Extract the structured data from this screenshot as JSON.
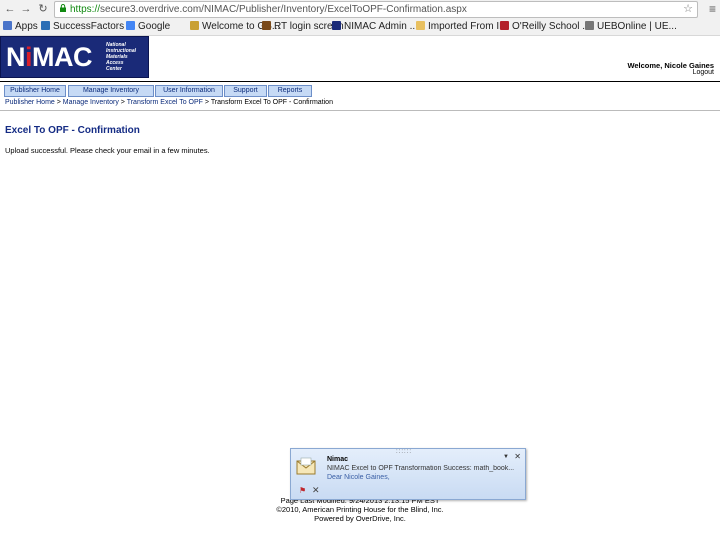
{
  "browser": {
    "url_scheme": "https://",
    "url_rest": "secure3.overdrive.com/NIMAC/Publisher/Inventory/ExcelToOPF-Confirmation.aspx",
    "bookmarks": [
      {
        "label": "Apps",
        "icon": "apps-grid-icon",
        "color": "#4a74c9"
      },
      {
        "label": "SuccessFactors ...",
        "icon": "successfactors-icon",
        "color": "#2d6fb5"
      },
      {
        "label": "Google",
        "icon": "google-icon",
        "color": "#4285f4"
      },
      {
        "label": "Welcome to GS...",
        "icon": "page-icon",
        "color": "#c9a032"
      },
      {
        "label": "RT login screen",
        "icon": "rt-icon",
        "color": "#7a4a1a"
      },
      {
        "label": "NIMAC Admin ...",
        "icon": "nimac-icon",
        "color": "#1a2a78"
      },
      {
        "label": "Imported From IE",
        "icon": "folder-icon",
        "color": "#e8c060"
      },
      {
        "label": "O'Reilly School ...",
        "icon": "oreilly-icon",
        "color": "#b3202a"
      },
      {
        "label": "UEBOnline | UE...",
        "icon": "page-icon",
        "color": "#777777"
      }
    ]
  },
  "header": {
    "logo_text_pre": "N",
    "logo_text_i": "i",
    "logo_text_post": "MAC",
    "logo_lines": [
      "National",
      "Instructional",
      "Materials",
      "Access",
      "Center"
    ],
    "welcome": "Welcome, Nicole Gaines",
    "logout": "Logout"
  },
  "tabs": [
    "Publisher Home",
    "Manage Inventory",
    "User Information",
    "Support",
    "Reports"
  ],
  "breadcrumb": {
    "items": [
      "Publisher Home",
      "Manage Inventory",
      "Transform Excel To OPF",
      "Transform Excel To OPF - Confirmation"
    ],
    "separator": " > "
  },
  "main": {
    "title": "Excel To OPF - Confirmation",
    "message": "Upload successful. Please check your email in a few minutes."
  },
  "footer": {
    "line1": "Page Last Modified: 9/24/2013 2:13:15 PM EST",
    "line2": "©2010, American Printing House for the Blind, Inc.",
    "line3": "Powered by OverDrive, Inc."
  },
  "toast": {
    "title": "Nimac",
    "body": "NIMAC Excel to OPF Transformation Success: math_book...",
    "sub": "Dear Nicole Gaines,"
  },
  "colors": {
    "brand_navy": "#1a2a78",
    "brand_red": "#d81e2a",
    "tab_fill": "#c6daf5",
    "title_blue": "#142b84"
  }
}
